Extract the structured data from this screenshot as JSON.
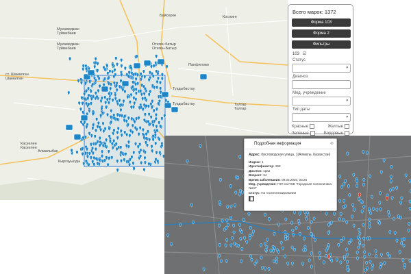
{
  "map_labels": [
    {
      "text": "Байсерке"
    },
    {
      "text": "Косозен"
    },
    {
      "text": "Мукамеджан\nТуймебаев"
    },
    {
      "text": "Мукамеджан\nТуймебаев"
    },
    {
      "text": "Отеген батыр\nОтеген-Батыр"
    },
    {
      "text": "Туздыбастау"
    },
    {
      "text": "Туздыбастау"
    },
    {
      "text": "ст. Шамалган\nШамалган"
    },
    {
      "text": "Талгар\nТалгар"
    },
    {
      "text": "Каскелен\nКаскелен"
    },
    {
      "text": "Кыргауылды"
    },
    {
      "text": "Панфилово"
    },
    {
      "text": "Алмалыбак"
    }
  ],
  "panel": {
    "total": "Всего марок: 1372",
    "buttons": [
      "Форма 103",
      "Форма 2",
      "Фильтры"
    ],
    "checkbox_103": "103",
    "status_label": "Статус",
    "diagnosis_label": "Диагноз",
    "med_label": "Мед. учреждение",
    "date_type_label": "Тип даты",
    "red": "Красные",
    "yellow": "Желтые",
    "green": "Зеленые",
    "burgundy": "Бордовые"
  },
  "popup": {
    "title": "Подробная информация",
    "address_label": "Адрес:",
    "address_value": "Кисловодская улица, 1(Алматы, Казахстан)",
    "rows": [
      {
        "k": "Индекс:",
        "v": "1"
      },
      {
        "k": "Идентификатор:",
        "v": "266"
      },
      {
        "k": "Диагноз:",
        "v": "орви"
      },
      {
        "k": "Возраст:",
        "v": "54"
      },
      {
        "k": "Время заболевания:",
        "v": "09.03.2020, 03:26"
      },
      {
        "k": "Мед. учреждение:",
        "v": "ГКП на ПХВ \"Городская поликлиника №23\""
      },
      {
        "k": "Статус:",
        "v": "На госпитализировании"
      }
    ],
    "close_glyph": "⊗"
  },
  "colors": {
    "marker_blue": "#1d86c8",
    "marker_red": "#d43c2c",
    "panel_button": "#3a3a3a",
    "dark_map": "#6e7071"
  },
  "icons": {
    "marker": "map-pin-icon",
    "cluster": "cluster-icon",
    "delete": "trash-icon"
  }
}
